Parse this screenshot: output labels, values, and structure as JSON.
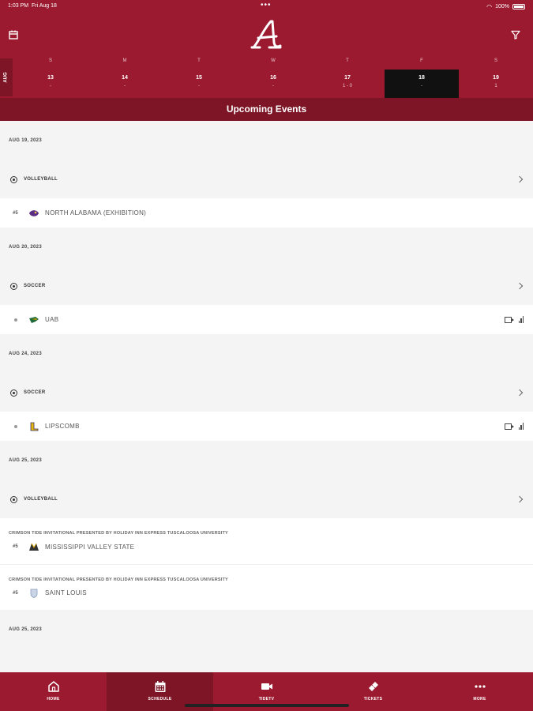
{
  "status": {
    "time": "1:03 PM",
    "date": "Fri Aug 18",
    "battery": "100%"
  },
  "calendar": {
    "month": "AUG",
    "weekdays": [
      "S",
      "M",
      "T",
      "W",
      "T",
      "F",
      "S"
    ],
    "days": [
      {
        "num": "13",
        "sub": "-"
      },
      {
        "num": "14",
        "sub": "-"
      },
      {
        "num": "15",
        "sub": "-"
      },
      {
        "num": "16",
        "sub": "-"
      },
      {
        "num": "17",
        "sub": "1 - 0"
      },
      {
        "num": "18",
        "sub": "-"
      },
      {
        "num": "19",
        "sub": "1"
      }
    ],
    "selected_index": 5
  },
  "upcoming_title": "Upcoming Events",
  "events": [
    {
      "date": "AUG 19, 2023",
      "sport": "VOLLEYBALL",
      "games": [
        {
          "rank": "#5",
          "opponent": "NORTH ALABAMA (EXHIBITION)",
          "tourney": "",
          "media": false
        }
      ]
    },
    {
      "date": "AUG 20, 2023",
      "sport": "SOCCER",
      "games": [
        {
          "rank": "",
          "opponent": "UAB",
          "tourney": "",
          "media": true
        }
      ]
    },
    {
      "date": "AUG 24, 2023",
      "sport": "SOCCER",
      "games": [
        {
          "rank": "",
          "opponent": "LIPSCOMB",
          "tourney": "",
          "media": true
        }
      ]
    },
    {
      "date": "AUG 25, 2023",
      "sport": "VOLLEYBALL",
      "games": [
        {
          "rank": "#5",
          "opponent": "MISSISSIPPI VALLEY STATE",
          "tourney": "CRIMSON TIDE INVITATIONAL PRESENTED BY HOLIDAY INN EXPRESS TUSCALOOSA UNIVERSITY",
          "media": false
        },
        {
          "rank": "#5",
          "opponent": "SAINT LOUIS",
          "tourney": "CRIMSON TIDE INVITATIONAL PRESENTED BY HOLIDAY INN EXPRESS TUSCALOOSA UNIVERSITY",
          "media": false
        }
      ]
    },
    {
      "date": "AUG 25, 2023",
      "sport": "",
      "games": []
    }
  ],
  "tabs": [
    {
      "label": "HOME",
      "icon": "home-icon"
    },
    {
      "label": "SCHEDULE",
      "icon": "calendar-icon"
    },
    {
      "label": "TIDETV",
      "icon": "video-icon"
    },
    {
      "label": "TICKETS",
      "icon": "ticket-icon"
    },
    {
      "label": "MORE",
      "icon": "more-icon"
    }
  ],
  "active_tab": 1,
  "colors": {
    "crimson": "#9b1a30",
    "crimson_dark": "#7e1526",
    "selected_day": "#111111"
  }
}
